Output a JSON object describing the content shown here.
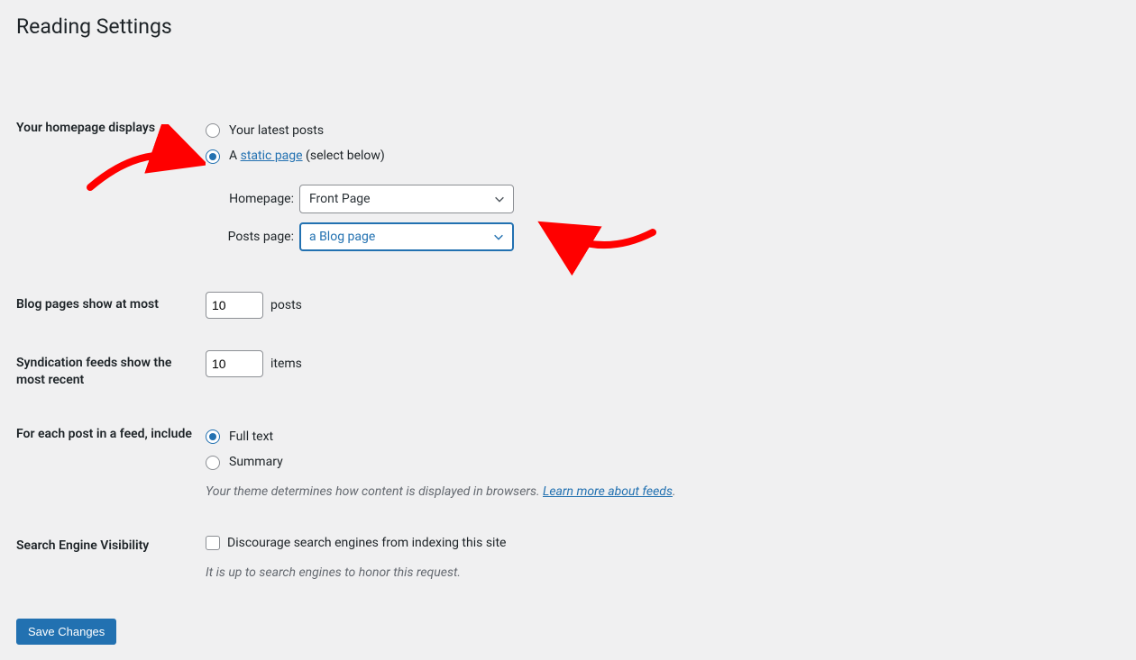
{
  "page_title": "Reading Settings",
  "homepage": {
    "label": "Your homepage displays",
    "opt_latest": "Your latest posts",
    "opt_static_prefix": "A ",
    "opt_static_link": "static page",
    "opt_static_suffix": " (select below)",
    "homepage_label": "Homepage:",
    "homepage_value": "Front Page",
    "posts_label": "Posts page:",
    "posts_value": "a Blog page"
  },
  "blog_pages": {
    "label": "Blog pages show at most",
    "value": "10",
    "unit": "posts"
  },
  "syndication": {
    "label": "Syndication feeds show the most recent",
    "value": "10",
    "unit": "items"
  },
  "feed_include": {
    "label": "For each post in a feed, include",
    "opt_full": "Full text",
    "opt_summary": "Summary",
    "note_prefix": "Your theme determines how content is displayed in browsers. ",
    "note_link": "Learn more about feeds",
    "note_suffix": "."
  },
  "search_vis": {
    "label": "Search Engine Visibility",
    "checkbox_label": "Discourage search engines from indexing this site",
    "note": "It is up to search engines to honor this request."
  },
  "save_button": "Save Changes"
}
